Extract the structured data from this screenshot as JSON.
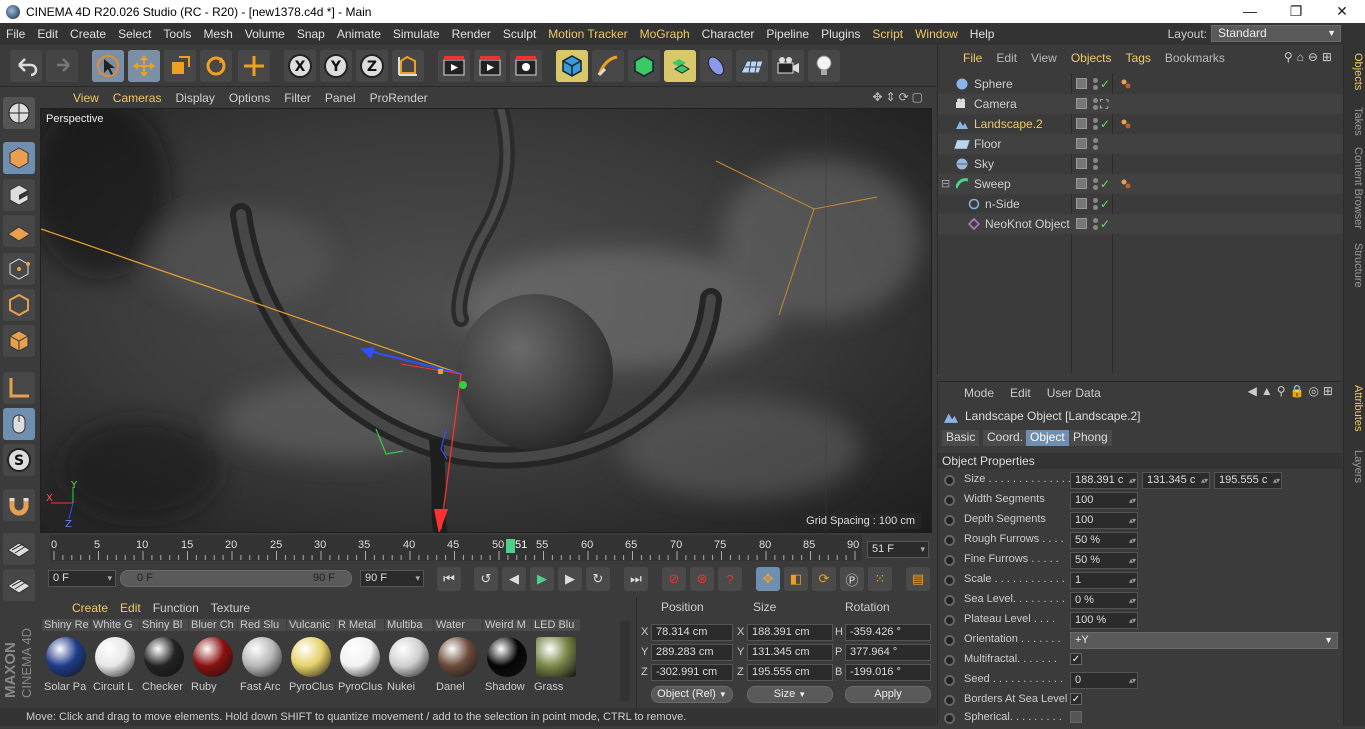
{
  "window": {
    "title": "CINEMA 4D R20.026 Studio (RC - R20) - [new1378.c4d *] - Main"
  },
  "menubar": {
    "items": [
      "File",
      "Edit",
      "Create",
      "Select",
      "Tools",
      "Mesh",
      "Volume",
      "Snap",
      "Animate",
      "Simulate",
      "Render",
      "Sculpt",
      "Motion Tracker",
      "MoGraph",
      "Character",
      "Pipeline",
      "Plugins",
      "Script",
      "Window",
      "Help"
    ],
    "layout_label": "Layout:",
    "layout_value": "Standard"
  },
  "viewport": {
    "menu": [
      "View",
      "Cameras",
      "Display",
      "Options",
      "Filter",
      "Panel",
      "ProRender"
    ],
    "camera_label": "Perspective",
    "grid_spacing": "Grid Spacing : 100 cm",
    "axis_x": "X",
    "axis_y": "Y",
    "axis_z": "Z"
  },
  "timeline": {
    "ticks": [
      "0",
      "5",
      "10",
      "15",
      "20",
      "25",
      "30",
      "35",
      "40",
      "45",
      "50",
      "55",
      "60",
      "65",
      "70",
      "75",
      "80",
      "85",
      "90"
    ],
    "current_marker": "51",
    "current_frame": "51 F"
  },
  "playback": {
    "start": "0 F",
    "range_start": "0 F",
    "range_end": "90 F",
    "end": "90 F"
  },
  "materials": {
    "menu": [
      "Create",
      "Edit",
      "Function",
      "Texture"
    ],
    "items": [
      {
        "top": "Shiny Re",
        "bottom": "Solar Pa",
        "color": "#1f3c8a"
      },
      {
        "top": "White G",
        "bottom": "Circuit L",
        "color": "#e8e8e8"
      },
      {
        "top": "Shiny Bl",
        "bottom": "Checker",
        "color": "#222222"
      },
      {
        "top": "Bluer Ch",
        "bottom": "Ruby",
        "color": "#8a1010"
      },
      {
        "top": "Red Slu",
        "bottom": "Fast Arc",
        "color": "#b8b8b8"
      },
      {
        "top": "Vulcanic",
        "bottom": "PyroClus",
        "color": "#e6d26a"
      },
      {
        "top": "R Metal",
        "bottom": "PyroClus",
        "color": "#f2f2f2"
      },
      {
        "top": "Multiba",
        "bottom": "Nukei",
        "color": "#d0d0d0"
      },
      {
        "top": "Water",
        "bottom": "Danel",
        "color": "#6b4a3a"
      },
      {
        "top": "Weird M",
        "bottom": "Shadow",
        "color": "#050505"
      },
      {
        "top": "LED Blu",
        "bottom": "Grass",
        "color": "#7a8a4a"
      }
    ]
  },
  "coordinates": {
    "headers": {
      "position": "Position",
      "size": "Size",
      "rotation": "Rotation"
    },
    "rows": [
      {
        "axis": "X",
        "pos": "78.314 cm",
        "saxis": "X",
        "size": "188.391 cm",
        "raxis": "H",
        "rot": "-359.426 °"
      },
      {
        "axis": "Y",
        "pos": "289.283 cm",
        "saxis": "Y",
        "size": "131.345 cm",
        "raxis": "P",
        "rot": "377.964 °"
      },
      {
        "axis": "Z",
        "pos": "-302.991 cm",
        "saxis": "Z",
        "size": "195.555 cm",
        "raxis": "B",
        "rot": "-199.016 °"
      }
    ],
    "mode": "Object (Rel)",
    "size_mode": "Size",
    "apply": "Apply"
  },
  "status": {
    "text": "Move: Click and drag to move elements. Hold down SHIFT to quantize movement / add to the selection in point mode, CTRL to remove."
  },
  "objects": {
    "menu": [
      "File",
      "Edit",
      "View",
      "Objects",
      "Tags",
      "Bookmarks"
    ],
    "items": [
      {
        "name": "Sphere",
        "icon": "sphere-icon"
      },
      {
        "name": "Camera",
        "icon": "camera-icon"
      },
      {
        "name": "Landscape.2",
        "icon": "landscape-icon"
      },
      {
        "name": "Floor",
        "icon": "floor-icon"
      },
      {
        "name": "Sky",
        "icon": "sky-icon"
      },
      {
        "name": "Sweep",
        "icon": "sweep-icon"
      },
      {
        "name": "n-Side",
        "icon": "nside-icon"
      },
      {
        "name": "NeoKnot Object",
        "icon": "neoknot-icon"
      }
    ]
  },
  "attributes": {
    "menu": [
      "Mode",
      "Edit",
      "User Data"
    ],
    "title": "Landscape Object [Landscape.2]",
    "tabs": [
      "Basic",
      "Coord.",
      "Object",
      "Phong"
    ],
    "section": "Object Properties",
    "props": {
      "size": {
        "label": "Size . . . . . . . . . . . . . . .",
        "v1": "188.391 c",
        "v2": "131.345 c",
        "v3": "195.555 c"
      },
      "width_segments": {
        "label": "Width Segments",
        "value": "100"
      },
      "depth_segments": {
        "label": "Depth Segments",
        "value": "100"
      },
      "rough_furrows": {
        "label": "Rough Furrows . . . .",
        "value": "50 %"
      },
      "fine_furrows": {
        "label": "Fine Furrows . . . . .",
        "value": "50 %"
      },
      "scale": {
        "label": "Scale . . . . . . . . . . . .",
        "value": "1"
      },
      "sea_level": {
        "label": "Sea Level. . . . . . . . .",
        "value": "0 %"
      },
      "plateau_level": {
        "label": "Plateau Level . . . .",
        "value": "100 %"
      },
      "orientation": {
        "label": "Orientation . . . . . . .",
        "value": "+Y"
      },
      "multifractal": {
        "label": "Multifractal. . . . . . .",
        "value": "✓"
      },
      "seed": {
        "label": "Seed . . . . . . . . . . . .",
        "value": "0"
      },
      "borders_sea": {
        "label": "Borders At Sea Level",
        "value": "✓"
      },
      "spherical": {
        "label": "Spherical. . . . . . . . ."
      }
    }
  },
  "sidetabs": [
    "Objects",
    "Takes",
    "Content Browser",
    "Structure",
    "Attributes",
    "Layers"
  ],
  "brand": {
    "line1": "MAXON",
    "line2": "CINEMA 4D"
  }
}
